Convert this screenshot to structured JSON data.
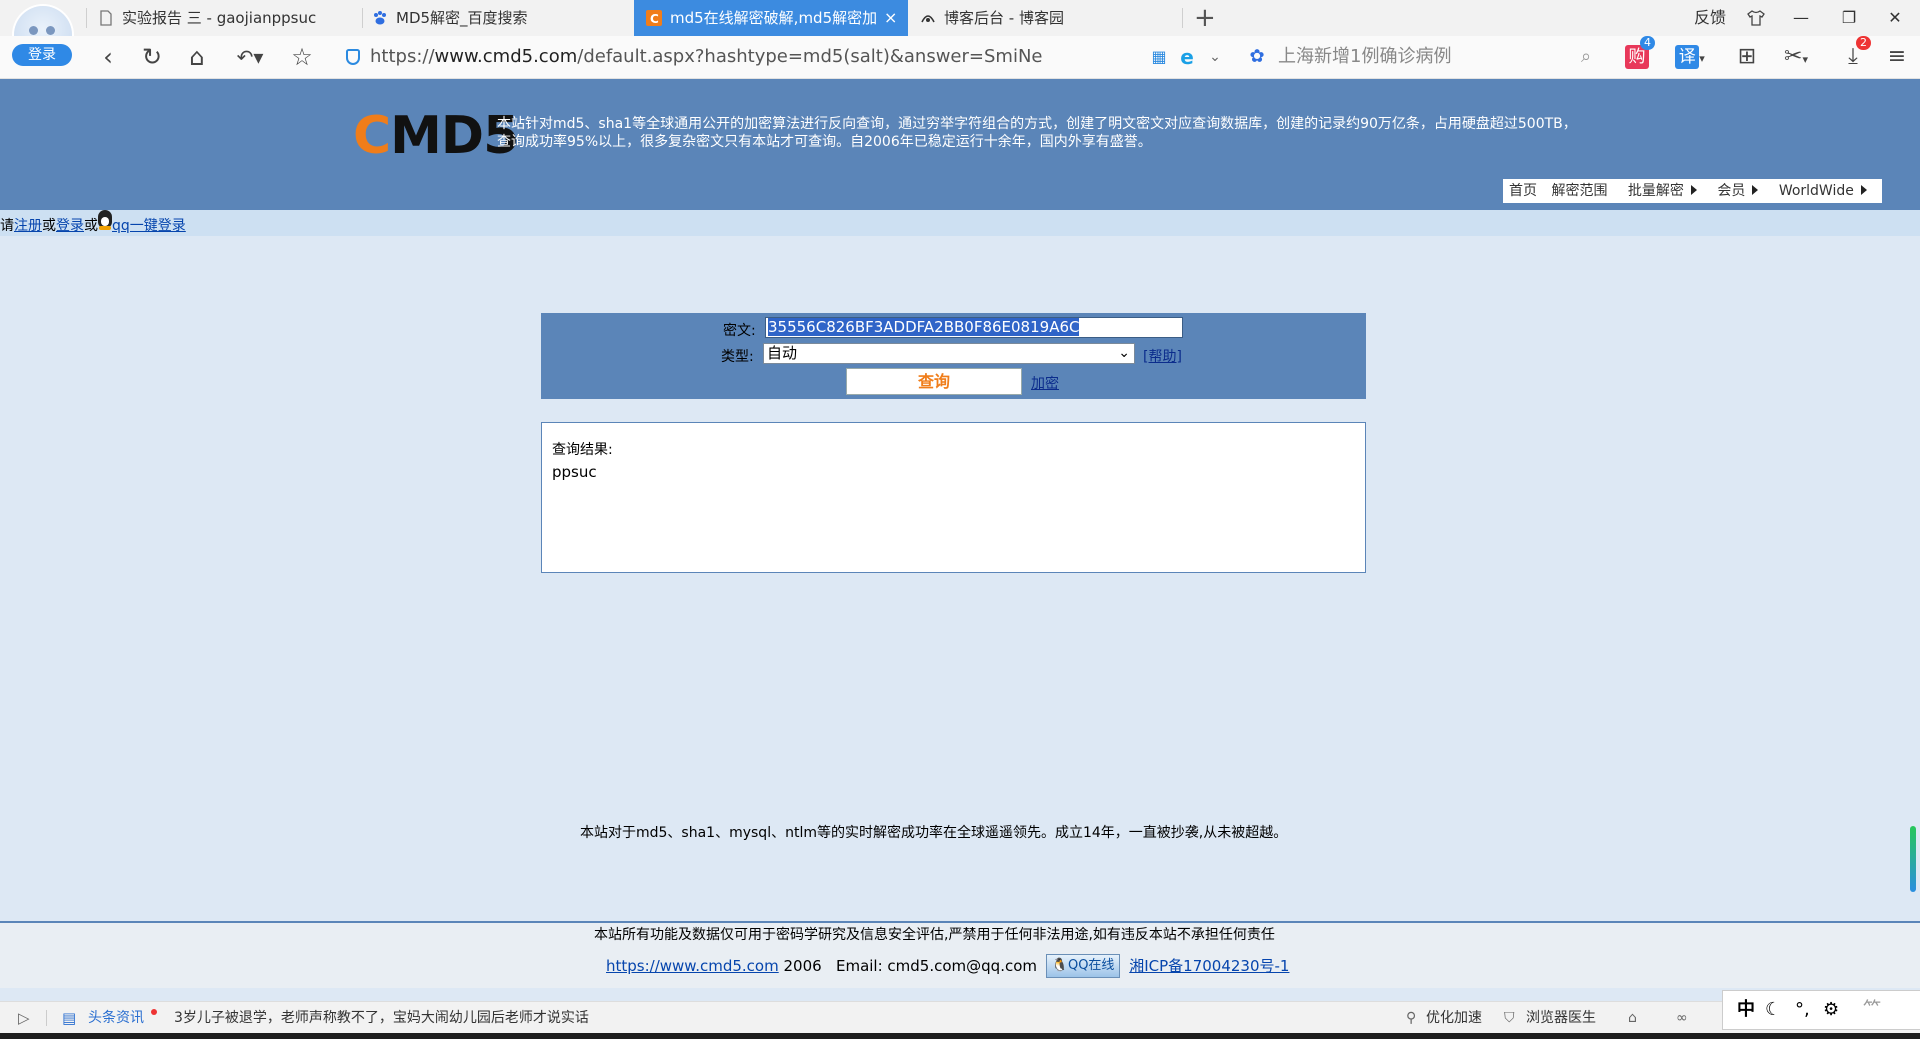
{
  "browser": {
    "login_label": "登录",
    "tabs": [
      {
        "label": "实验报告 三 - gaojianppsuc"
      },
      {
        "label": "MD5解密_百度搜索"
      },
      {
        "label": "md5在线解密破解,md5解密加"
      },
      {
        "label": "博客后台 - 博客园"
      }
    ],
    "tab_close": "×",
    "new_tab": "+",
    "feedback_label": "反馈",
    "address": {
      "prefix": "https://",
      "host": "www.cmd5.com",
      "path": "/default.aspx?hashtype=md5(salt)&answer=SmiNe"
    },
    "search_placeholder": "上海新增1例确诊病例",
    "shop_badge": "4",
    "translate_label": "译",
    "shop_label": "购",
    "download_badge": "2"
  },
  "site": {
    "logo_prefix": "C",
    "logo_rest": "MD5",
    "intro": "本站针对md5、sha1等全球通用公开的加密算法进行反向查询，通过穷举字符组合的方式，创建了明文密文对应查询数据库，创建的记录约90万亿条，占用硬盘超过500TB，查询成功率95%以上，很多复杂密文只有本站才可查询。自2006年已稳定运行十余年，国内外享有盛誉。",
    "menu": [
      "首页",
      "解密范围",
      "批量解密",
      "会员",
      "WorldWide"
    ]
  },
  "loginbar": {
    "prefix": "请",
    "register": "注册",
    "or1": "或",
    "login": "登录",
    "or2": "或",
    "qq_login": "qq一键登录"
  },
  "query": {
    "cipher_label": "密文:",
    "cipher_value": "35556C826BF3ADDFA2BB0F86E0819A6C",
    "type_label": "类型:",
    "type_value": "自动",
    "help_link": "[帮助]",
    "submit_label": "查询",
    "encrypt_link": "加密"
  },
  "result": {
    "title": "查询结果:",
    "value": "ppsuc"
  },
  "slogan": "本站对于md5、sha1、mysql、ntlm等的实时解密成功率在全球遥遥领先。成立14年，一直被抄袭,从未被超越。",
  "footer": {
    "disclaimer": "本站所有功能及数据仅可用于密码学研究及信息安全评估,严禁用于任何非法用途,如有违反本站不承担任何责任",
    "site_link": "https://www.cmd5.com",
    "year": "2006",
    "email": "Email: cmd5.com@qq.com",
    "qq_online": "QQ在线",
    "icp": "湘ICP备17004230号-1"
  },
  "statusbar": {
    "news_label": "头条资讯",
    "news_text": "3岁儿子被退学，老师声称教不了，宝妈大闹幼儿园后老师才说实话",
    "optimize": "优化加速",
    "doctor": "浏览器医生"
  },
  "ime": {
    "mode": "中"
  }
}
